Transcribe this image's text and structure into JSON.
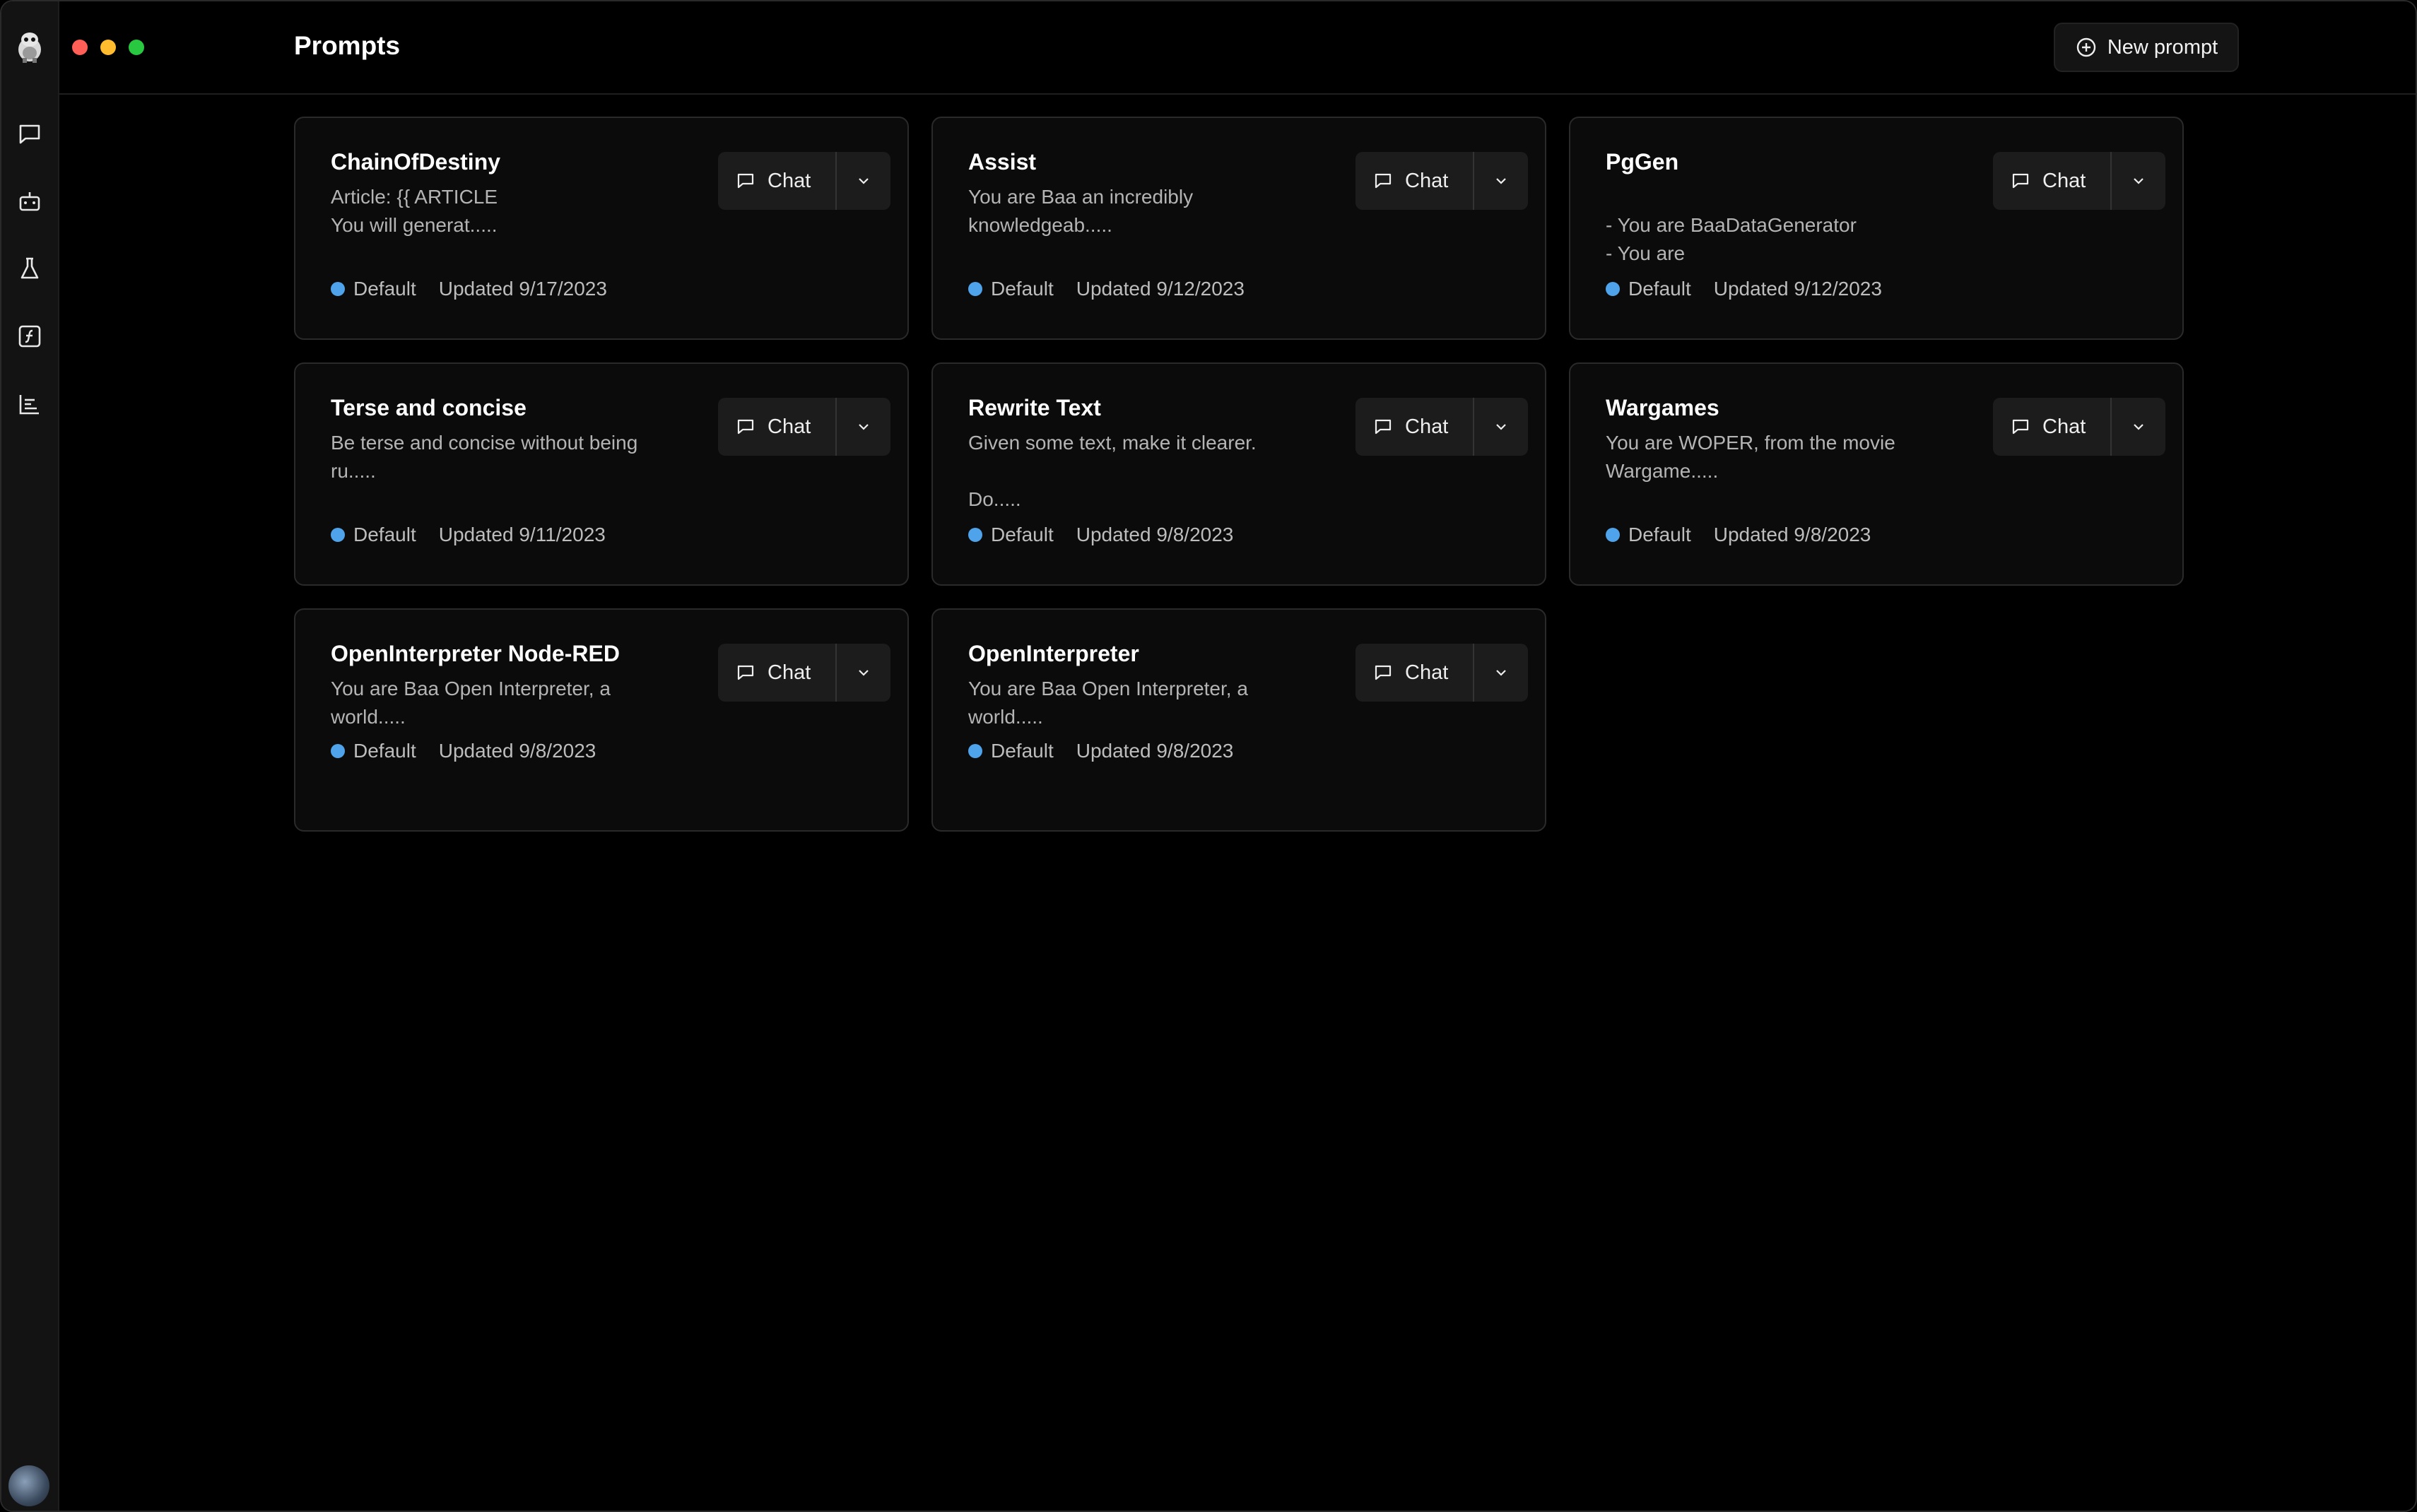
{
  "header": {
    "title": "Prompts",
    "new_prompt_label": "New prompt"
  },
  "sidebar": {
    "items": [
      "chat-icon",
      "robot-icon",
      "flask-icon",
      "function-icon",
      "chart-icon"
    ]
  },
  "prompts": [
    {
      "title": "ChainOfDestiny",
      "description": "Article: {{ ARTICLE\nYou will generat.....",
      "tag": "Default",
      "updated": "Updated 9/17/2023",
      "chat_label": "Chat"
    },
    {
      "title": "Assist",
      "description": "You are Baa an incredibly\nknowledgeab.....",
      "tag": "Default",
      "updated": "Updated 9/12/2023",
      "chat_label": "Chat"
    },
    {
      "title": "PgGen",
      "description": "\n- You are BaaDataGenerator\n- You are",
      "tag": "Default",
      "updated": "Updated 9/12/2023",
      "chat_label": "Chat"
    },
    {
      "title": "Terse and concise",
      "description": "Be terse and concise without being\nru.....",
      "tag": "Default",
      "updated": "Updated 9/11/2023",
      "chat_label": "Chat"
    },
    {
      "title": "Rewrite Text",
      "description": "Given some text, make it clearer.\n\nDo.....",
      "tag": "Default",
      "updated": "Updated 9/8/2023",
      "chat_label": "Chat"
    },
    {
      "title": "Wargames",
      "description": "You are WOPER, from the movie\nWargame.....",
      "tag": "Default",
      "updated": "Updated 9/8/2023",
      "chat_label": "Chat"
    },
    {
      "title": "OpenInterpreter Node-RED",
      "description": "You are Baa Open Interpreter, a\nworld.....",
      "tag": "Default",
      "updated": "Updated 9/8/2023",
      "chat_label": "Chat"
    },
    {
      "title": "OpenInterpreter",
      "description": "You are Baa Open Interpreter, a\nworld.....",
      "tag": "Default",
      "updated": "Updated 9/8/2023",
      "chat_label": "Chat"
    }
  ],
  "colors": {
    "tag_dot": "#4ea3ea",
    "background": "#000000",
    "card": "#0b0b0b"
  }
}
